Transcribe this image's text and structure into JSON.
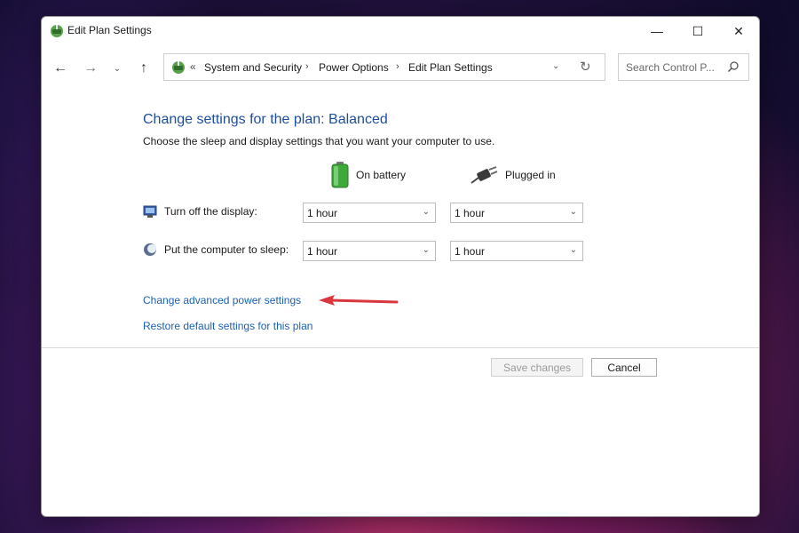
{
  "window": {
    "title": "Edit Plan Settings",
    "controls": {
      "minimize": "—",
      "maximize": "☐",
      "close": "✕"
    }
  },
  "nav": {
    "back": "←",
    "forward": "→",
    "recent": "⌄",
    "up": "↑"
  },
  "address": {
    "prefix": "«",
    "crumbs": [
      "System and Security",
      "Power Options",
      "Edit Plan Settings"
    ],
    "separator": "›",
    "dropdown": "⌄",
    "refresh": "↻"
  },
  "search": {
    "placeholder": "Search Control P..."
  },
  "main": {
    "heading": "Change settings for the plan: Balanced",
    "subheading": "Choose the sleep and display settings that you want your computer to use.",
    "columns": {
      "battery": "On battery",
      "plugged": "Plugged in"
    },
    "rows": [
      {
        "label": "Turn off the display:",
        "battery": "1 hour",
        "plugged": "1 hour"
      },
      {
        "label": "Put the computer to sleep:",
        "battery": "1 hour",
        "plugged": "1 hour"
      }
    ],
    "links": {
      "advanced": "Change advanced power settings",
      "restore": "Restore default settings for this plan"
    }
  },
  "buttons": {
    "save": "Save changes",
    "cancel": "Cancel"
  },
  "colors": {
    "heading": "#1e4e9c",
    "link": "#1a62b3",
    "arrow": "#d9363e"
  }
}
